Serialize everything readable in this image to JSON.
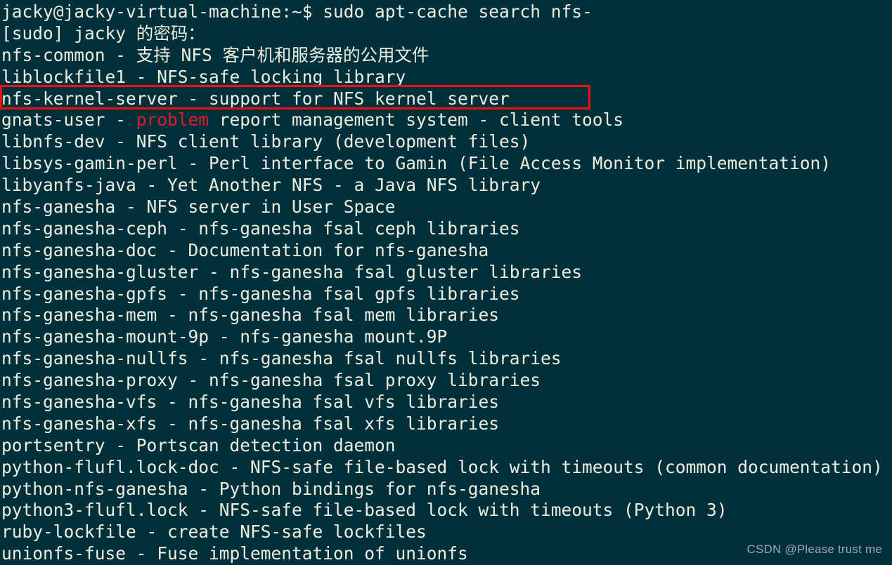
{
  "terminal": {
    "colors": {
      "background": "#01303d",
      "foreground": "#eeeedd",
      "error_text": "#e01b24",
      "highlight_border": "#ee1111",
      "watermark": "#9aa9ad"
    },
    "prompt": "jacky@jacky-virtual-machine:~$ ",
    "command": "sudo apt-cache search nfs-",
    "lines": [
      {
        "id": "prompt-line",
        "text": "jacky@jacky-virtual-machine:~$ sudo apt-cache search nfs-"
      },
      {
        "id": "sudo-password-prompt",
        "text": "[sudo] jacky 的密码："
      },
      {
        "id": "pkg-nfs-common",
        "text": "nfs-common - 支持 NFS 客户机和服务器的公用文件"
      },
      {
        "id": "pkg-liblockfile1",
        "text": "liblockfile1 - NFS-safe locking library"
      },
      {
        "id": "pkg-nfs-kernel-server",
        "text": "nfs-kernel-server - support for NFS kernel server"
      },
      {
        "id": "pkg-gnats-user",
        "text": "gnats-user - problem report management system - client tools",
        "error_word": "problem",
        "prefix": "gnats-user - ",
        "suffix": " report management system - client tools"
      },
      {
        "id": "pkg-libnfs-dev",
        "text": "libnfs-dev - NFS client library (development files)"
      },
      {
        "id": "pkg-libsys-gamin-perl",
        "text": "libsys-gamin-perl - Perl interface to Gamin (File Access Monitor implementation)"
      },
      {
        "id": "pkg-libyanfs-java",
        "text": "libyanfs-java - Yet Another NFS - a Java NFS library"
      },
      {
        "id": "pkg-nfs-ganesha",
        "text": "nfs-ganesha - NFS server in User Space"
      },
      {
        "id": "pkg-nfs-ganesha-ceph",
        "text": "nfs-ganesha-ceph - nfs-ganesha fsal ceph libraries"
      },
      {
        "id": "pkg-nfs-ganesha-doc",
        "text": "nfs-ganesha-doc - Documentation for nfs-ganesha"
      },
      {
        "id": "pkg-nfs-ganesha-gluster",
        "text": "nfs-ganesha-gluster - nfs-ganesha fsal gluster libraries"
      },
      {
        "id": "pkg-nfs-ganesha-gpfs",
        "text": "nfs-ganesha-gpfs - nfs-ganesha fsal gpfs libraries"
      },
      {
        "id": "pkg-nfs-ganesha-mem",
        "text": "nfs-ganesha-mem - nfs-ganesha fsal mem libraries"
      },
      {
        "id": "pkg-nfs-ganesha-mount-9p",
        "text": "nfs-ganesha-mount-9p - nfs-ganesha mount.9P"
      },
      {
        "id": "pkg-nfs-ganesha-nullfs",
        "text": "nfs-ganesha-nullfs - nfs-ganesha fsal nullfs libraries"
      },
      {
        "id": "pkg-nfs-ganesha-proxy",
        "text": "nfs-ganesha-proxy - nfs-ganesha fsal proxy libraries"
      },
      {
        "id": "pkg-nfs-ganesha-vfs",
        "text": "nfs-ganesha-vfs - nfs-ganesha fsal vfs libraries"
      },
      {
        "id": "pkg-nfs-ganesha-xfs",
        "text": "nfs-ganesha-xfs - nfs-ganesha fsal xfs libraries"
      },
      {
        "id": "pkg-portsentry",
        "text": "portsentry - Portscan detection daemon"
      },
      {
        "id": "pkg-python-flufl-lock-doc",
        "text": "python-flufl.lock-doc - NFS-safe file-based lock with timeouts (common documentation)"
      },
      {
        "id": "pkg-python-nfs-ganesha",
        "text": "python-nfs-ganesha - Python bindings for nfs-ganesha"
      },
      {
        "id": "pkg-python3-flufl-lock",
        "text": "python3-flufl.lock - NFS-safe file-based lock with timeouts (Python 3)"
      },
      {
        "id": "pkg-ruby-lockfile",
        "text": "ruby-lockfile - create NFS-safe lockfiles"
      },
      {
        "id": "pkg-unionfs-fuse",
        "text": "unionfs-fuse - Fuse implementation of unionfs"
      }
    ]
  },
  "highlight": {
    "label": "nfs-kernel-server-highlight",
    "target_line_id": "pkg-nfs-kernel-server"
  },
  "watermark": {
    "text": "CSDN @Please trust me"
  }
}
